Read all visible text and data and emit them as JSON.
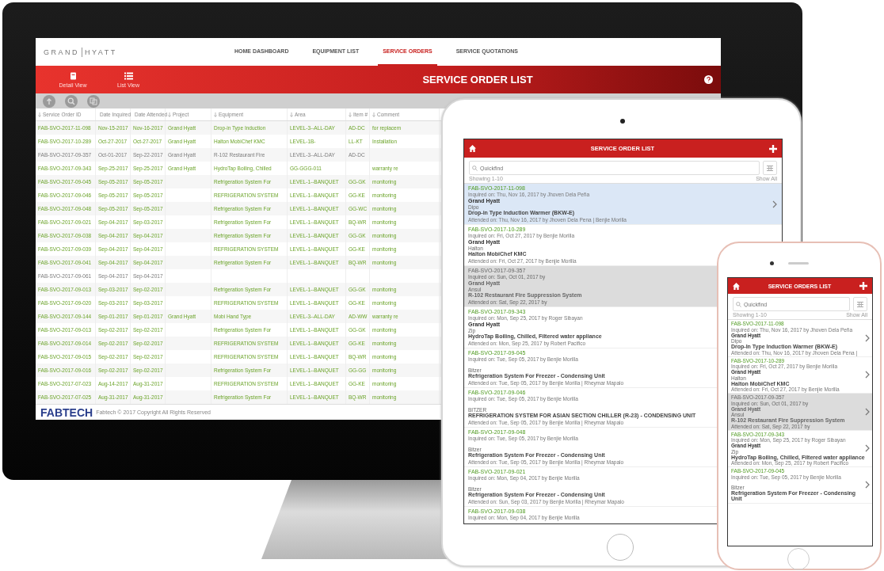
{
  "monitor": {
    "logo": {
      "left": "GRAND",
      "right": "HYATT"
    },
    "nav": [
      {
        "label": "HOME DASHBOARD",
        "selected": false
      },
      {
        "label": "EQUIPMENT LIST",
        "selected": false
      },
      {
        "label": "SERVICE ORDERS",
        "selected": true
      },
      {
        "label": "SERVICE QUOTATIONS",
        "selected": false
      }
    ],
    "views": [
      {
        "label": "Detail View",
        "kind": "detail"
      },
      {
        "label": "List View",
        "kind": "list"
      }
    ],
    "title": "SERVICE ORDER LIST",
    "table": {
      "columns": [
        "Service Order ID",
        "Date Inquired",
        "Date Attended",
        "Project",
        "Equipment",
        "Area",
        "Item #",
        "Comment"
      ],
      "rows": [
        {
          "id": "FAB-SVO-2017-11-098",
          "inquired": "Nov-15-2017",
          "attended": "Nov-16-2017",
          "project": "Grand Hyatt",
          "equipment": "Drop-in Type Induction",
          "area": "LEVEL-3--ALL-DAY",
          "item": "AD-DC",
          "comment": "for replacem",
          "cancelled": false
        },
        {
          "id": "FAB-SVO-2017-10-289",
          "inquired": "Oct-27-2017",
          "attended": "Oct-27-2017",
          "project": "Grand Hyatt",
          "equipment": "Halton MobiChef KMC",
          "area": "LEVEL-1B-",
          "item": "LL-KT",
          "comment": "Installation",
          "cancelled": false
        },
        {
          "id": "FAB-SVO-2017-09-357",
          "inquired": "Oct-01-2017",
          "attended": "Sep-22-2017",
          "project": "Grand Hyatt",
          "equipment": "R-102 Restaurant Fire",
          "area": "LEVEL-3--ALL-DAY",
          "item": "AD-DC",
          "cancelled": true
        },
        {
          "id": "FAB-SVO-2017-09-343",
          "inquired": "Sep-25-2017",
          "attended": "Sep-25-2017",
          "project": "Grand Hyatt",
          "equipment": "HydroTap Boiling, Chilled",
          "area": "GG-GGG-011",
          "comment": "warranty re",
          "cancelled": false
        },
        {
          "id": "FAB-SVO-2017-09-045",
          "inquired": "Sep-05-2017",
          "attended": "Sep-05-2017",
          "equipment": "Refrigeration System For",
          "area": "LEVEL-1--BANQUET",
          "item": "GG-GK",
          "comment": "monitoring",
          "cancelled": false
        },
        {
          "id": "FAB-SVO-2017-09-046",
          "inquired": "Sep-05-2017",
          "attended": "Sep-05-2017",
          "equipment": "REFRIGERATION SYSTEM",
          "area": "LEVEL-1--BANQUET",
          "item": "GG-KE",
          "comment": "monitoring",
          "cancelled": false
        },
        {
          "id": "FAB-SVO-2017-09-048",
          "inquired": "Sep-05-2017",
          "attended": "Sep-05-2017",
          "equipment": "Refrigeration System For",
          "area": "LEVEL-1--BANQUET",
          "item": "GG-WC",
          "comment": "monitoring",
          "cancelled": false
        },
        {
          "id": "FAB-SVO-2017-09-021",
          "inquired": "Sep-04-2017",
          "attended": "Sep-03-2017",
          "equipment": "Refrigeration System For",
          "area": "LEVEL-1--BANQUET",
          "item": "BQ-WR",
          "comment": "monitoring",
          "cancelled": false
        },
        {
          "id": "FAB-SVO-2017-09-038",
          "inquired": "Sep-04-2017",
          "attended": "Sep-04-2017",
          "equipment": "Refrigeration System For",
          "area": "LEVEL-1--BANQUET",
          "item": "GG-GK",
          "comment": "monitoring",
          "cancelled": false
        },
        {
          "id": "FAB-SVO-2017-09-039",
          "inquired": "Sep-04-2017",
          "attended": "Sep-04-2017",
          "equipment": "REFRIGERATION SYSTEM",
          "area": "LEVEL-1--BANQUET",
          "item": "GG-KE",
          "comment": "monitoring",
          "cancelled": false
        },
        {
          "id": "FAB-SVO-2017-09-041",
          "inquired": "Sep-04-2017",
          "attended": "Sep-04-2017",
          "equipment": "Refrigeration System For",
          "area": "LEVEL-1--BANQUET",
          "item": "BQ-WR",
          "comment": "monitoring",
          "cancelled": false
        },
        {
          "id": "FAB-SVO-2017-09-061",
          "inquired": "Sep-04-2017",
          "attended": "Sep-04-2017",
          "cancelled": true
        },
        {
          "id": "FAB-SVO-2017-09-013",
          "inquired": "Sep-03-2017",
          "attended": "Sep-02-2017",
          "equipment": "Refrigeration System For",
          "area": "LEVEL-1--BANQUET",
          "item": "GG-GK",
          "comment": "monitoring",
          "cancelled": false
        },
        {
          "id": "FAB-SVO-2017-09-020",
          "inquired": "Sep-03-2017",
          "attended": "Sep-03-2017",
          "equipment": "REFRIGERATION SYSTEM",
          "area": "LEVEL-1--BANQUET",
          "item": "GG-KE",
          "comment": "monitoring",
          "cancelled": false
        },
        {
          "id": "FAB-SVO-2017-09-144",
          "inquired": "Sep-01-2017",
          "attended": "Sep-01-2017",
          "project": "Grand Hyatt",
          "equipment": "Mobi Hand Type",
          "area": "LEVEL-3--ALL-DAY",
          "item": "AD-WW",
          "comment": "warranty re",
          "cancelled": false
        },
        {
          "id": "FAB-SVO-2017-09-013",
          "inquired": "Sep-02-2017",
          "attended": "Sep-02-2017",
          "equipment": "Refrigeration System For",
          "area": "LEVEL-1--BANQUET",
          "item": "GG-GK",
          "comment": "monitoring",
          "cancelled": false
        },
        {
          "id": "FAB-SVO-2017-09-014",
          "inquired": "Sep-02-2017",
          "attended": "Sep-02-2017",
          "equipment": "REFRIGERATION SYSTEM",
          "area": "LEVEL-1--BANQUET",
          "item": "GG-KE",
          "comment": "monitoring",
          "cancelled": false
        },
        {
          "id": "FAB-SVO-2017-09-015",
          "inquired": "Sep-02-2017",
          "attended": "Sep-02-2017",
          "equipment": "REFRIGERATION SYSTEM",
          "area": "LEVEL-1--BANQUET",
          "item": "BQ-WR",
          "comment": "monitoring",
          "cancelled": false
        },
        {
          "id": "FAB-SVO-2017-09-016",
          "inquired": "Sep-02-2017",
          "attended": "Sep-02-2017",
          "equipment": "Refrigeration System For",
          "area": "LEVEL-1--BANQUET",
          "item": "GG-GG",
          "comment": "monitoring",
          "cancelled": false
        },
        {
          "id": "FAB-SVO-2017-07-023",
          "inquired": "Aug-14-2017",
          "attended": "Aug-31-2017",
          "equipment": "REFRIGERATION SYSTEM",
          "area": "LEVEL-1--BANQUET",
          "item": "GG-KE",
          "comment": "monitoring",
          "cancelled": false
        },
        {
          "id": "FAB-SVO-2017-07-025",
          "inquired": "Aug-31-2017",
          "attended": "Aug-31-2017",
          "equipment": "Refrigeration System For",
          "area": "LEVEL-1--BANQUET",
          "item": "BQ-WR",
          "comment": "monitoring",
          "cancelled": false
        }
      ]
    },
    "footer": {
      "brand": "FABTECH",
      "copyright": "Fabtech © 2017 Copyright All Rights Reserved"
    }
  },
  "tablet": {
    "title": "SERVICE ORDER LIST",
    "search": {
      "placeholder": "Quickfind"
    },
    "showing": "Showing 1-10",
    "show_all": "Show All",
    "orders": [
      {
        "id": "FAB-SVO-2017-11-098",
        "inquired": "Inquired on: Thu, Nov 16, 2017 by Jhoven Dela Peña",
        "project": "Grand Hyatt",
        "brand": "Dipo",
        "equipment": "Drop-in Type Induction Warmer (BKW-E)",
        "attended": "Attended on: Thu, Nov 16, 2017 by Jhoven Dela Pena | Benjie Morilla",
        "selected": true,
        "cancelled": false
      },
      {
        "id": "FAB-SVO-2017-10-289",
        "inquired": "Inquired on: Fri, Oct 27, 2017 by Benjie Morilla",
        "project": "Grand Hyatt",
        "brand": "Halton",
        "equipment": "Halton MobiChef KMC",
        "attended": "Attended on: Fri, Oct 27, 2017 by Benjie Morilla",
        "selected": false,
        "cancelled": false
      },
      {
        "id": "FAB-SVO-2017-09-357",
        "inquired": "Inquired on: Sun, Oct 01, 2017 by",
        "project": "Grand Hyatt",
        "brand": "Ansul",
        "equipment": "R-102 Restaurant Fire Suppression System",
        "attended": "Attended on: Sat, Sep 22, 2017 by",
        "selected": false,
        "cancelled": true
      },
      {
        "id": "FAB-SVO-2017-09-343",
        "inquired": "Inquired on: Mon, Sep 25, 2017 by Roger Sibayan",
        "project": "Grand Hyatt",
        "brand": "Zip",
        "equipment": "HydroTap Boiling, Chilled, Filtered water appliance",
        "attended": "Attended on: Mon, Sep 25, 2017 by Robert Pacifico",
        "selected": false,
        "cancelled": false
      },
      {
        "id": "FAB-SVO-2017-09-045",
        "inquired": "Inquired on: Tue, Sep 05, 2017 by Benjie Morilla",
        "brand": "Bitzer",
        "equipment": "Refrigeration System For Freezer - Condensing Unit",
        "attended": "Attended on: Tue, Sep 05, 2017 by Benjie Morilla | Rheymar Mapalo",
        "selected": false,
        "cancelled": false
      },
      {
        "id": "FAB-SVO-2017-09-046",
        "inquired": "Inquired on: Tue, Sep 05, 2017 by Benjie Morilla",
        "brand": "BITZER",
        "equipment": "REFRIGERATION SYSTEM FOR ASIAN SECTION CHILLER (R-23) - CONDENSING UNIT",
        "attended": "Attended on: Tue, Sep 05, 2017 by Benjie Morilla | Rheymar Mapalo",
        "selected": false,
        "cancelled": false
      },
      {
        "id": "FAB-SVO-2017-09-048",
        "inquired": "Inquired on: Tue, Sep 05, 2017 by Benjie Morilla",
        "brand": "Bitzer",
        "equipment": "Refrigeration System For Freezer - Condensing Unit",
        "attended": "Attended on: Tue, Sep 05, 2017 by Benjie Morilla | Rheymar Mapalo",
        "selected": false,
        "cancelled": false
      },
      {
        "id": "FAB-SVO-2017-09-021",
        "inquired": "Inquired on: Mon, Sep 04, 2017 by Benjie Morilla",
        "brand": "Bitzer",
        "equipment": "Refrigeration System For Freezer - Condensing Unit",
        "attended": "Attended on: Sun, Sep 03, 2017 by Benjie Morilla | Rheymar Mapalo",
        "selected": false,
        "cancelled": false
      },
      {
        "id": "FAB-SVO-2017-09-038",
        "inquired": "Inquired on: Mon, Sep 04, 2017 by Benjie Morilla",
        "selected": false,
        "cancelled": false
      }
    ]
  },
  "phone": {
    "title": "SERVICE ORDERS LIST",
    "search": {
      "placeholder": "Quickfind"
    },
    "showing": "Showing 1-10",
    "show_all": "Show All",
    "orders": [
      {
        "id": "FAB-SVO-2017-11-098",
        "inquired": "Inquired on: Thu, Nov 16, 2017 by Jhoven Dela Peña",
        "project": "Grand Hyatt",
        "brand": "Dipo",
        "equipment": "Drop-In Type Induction Warmer (BKW-E)",
        "attended": "Attended on: Thu, Nov 16, 2017 by Jhoven Dela Pena |",
        "cancelled": false
      },
      {
        "id": "FAB-SVO-2017-10-289",
        "inquired": "Inquired on: Fri, Oct 27, 2017 by Benjie Morilla",
        "project": "Grand Hyatt",
        "brand": "Halton",
        "equipment": "Halton MobiChef KMC",
        "attended": "Attended on: Fri, Oct 27, 2017 by Benjie Morilla",
        "cancelled": false
      },
      {
        "id": "FAB-SVO-2017-09-357",
        "inquired": "Inquired on: Sun, Oct 01, 2017 by",
        "project": "Grand Hyatt",
        "brand": "Ansul",
        "equipment": "R-102 Restaurant Fire Suppression System",
        "attended": "Attended on: Sat, Sep 22, 2017 by",
        "cancelled": true
      },
      {
        "id": "FAB-SVO-2017-09-343",
        "inquired": "Inquired on: Mon, Sep 25, 2017 by Roger Sibayan",
        "project": "Grand Hyatt",
        "brand": "Zip",
        "equipment": "HydroTap Boiling, Chilled, Filtered water appliance",
        "attended": "Attended on: Mon, Sep 25, 2017 by Robert Pacifico",
        "cancelled": false
      },
      {
        "id": "FAB-SVO-2017-09-045",
        "inquired": "Inquired on: Tue, Sep 05, 2017 by Benjie Morilla",
        "brand": "Bitzer",
        "equipment": "Refrigeration System For Freezer - Condensing Unit",
        "cancelled": false
      }
    ]
  }
}
